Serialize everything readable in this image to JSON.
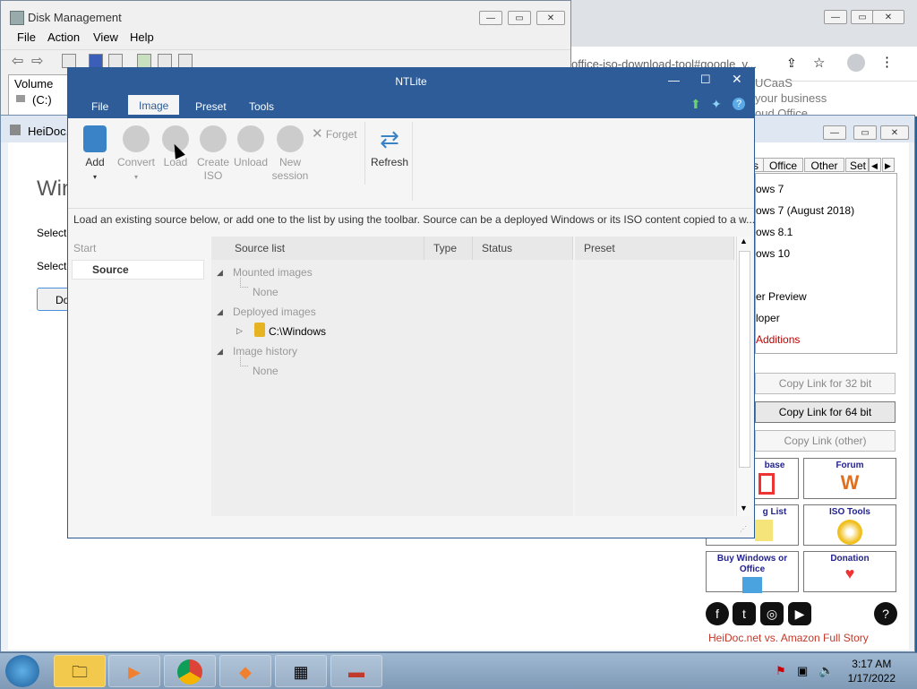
{
  "chrome": {
    "url": "office-iso-download-tool#google_v...",
    "page_lines": [
      "UCaaS",
      "your business",
      "oud Office"
    ]
  },
  "disk_management": {
    "title": "Disk Management",
    "menu": [
      "File",
      "Action",
      "View",
      "Help"
    ],
    "col_volume": "Volume",
    "row_c": "(C:)"
  },
  "heidoc": {
    "title": "HeiDoc.n",
    "heading": "Win",
    "select_1": "Select",
    "select_2": "Select t",
    "button": "Do",
    "tabs": [
      "Office",
      "Other",
      "Set"
    ],
    "os_list": [
      "ows 7",
      "ows 7 (August 2018)",
      "ows 8.1",
      "ows 10",
      "er Preview",
      "loper",
      "Additions"
    ],
    "copy_32": "Copy Link for 32 bit",
    "copy_64": "Copy Link for 64 bit",
    "copy_other": "Copy Link (other)",
    "tiles": [
      "base",
      "Forum",
      "g List",
      "ISO Tools",
      "Buy Windows or Office",
      "Donation"
    ],
    "footer_link": "HeiDoc.net vs. Amazon Full Story",
    "help": "?"
  },
  "ntlite": {
    "title": "NTLite",
    "menu": [
      "File",
      "Image",
      "Preset",
      "Tools"
    ],
    "ribbon": {
      "add": "Add",
      "convert": "Convert",
      "load": "Load",
      "create_iso": "Create ISO",
      "unload": "Unload",
      "new_session": "New session",
      "forget": "Forget",
      "refresh": "Refresh"
    },
    "info": "Load an existing source below, or add one to the list by using the toolbar. Source can be a deployed Windows or its ISO content copied to a w...",
    "left": {
      "start": "Start",
      "source": "Source"
    },
    "columns": [
      "Source list",
      "Type",
      "Status",
      "Preset"
    ],
    "tree": {
      "mounted": "Mounted images",
      "none1": "None",
      "deployed": "Deployed images",
      "windows": "C:\\Windows",
      "history": "Image history",
      "none2": "None"
    }
  },
  "taskbar": {
    "time": "3:17 AM",
    "date": "1/17/2022"
  }
}
